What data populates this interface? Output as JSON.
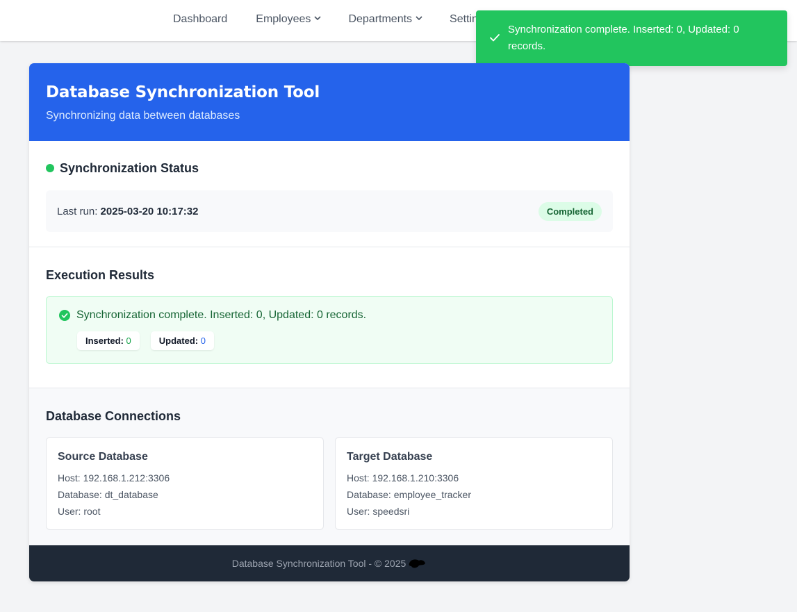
{
  "nav": {
    "items": [
      {
        "label": "Dashboard",
        "dropdown": false
      },
      {
        "label": "Employees",
        "dropdown": true
      },
      {
        "label": "Departments",
        "dropdown": true
      },
      {
        "label": "Settings",
        "dropdown": false
      }
    ]
  },
  "toast": {
    "icon": "check-icon",
    "message": "Synchronization complete. Inserted: 0, Updated: 0 records.",
    "color": "#22c55e"
  },
  "header": {
    "title": "Database Synchronization Tool",
    "subtitle": "Synchronizing data between databases",
    "color": "#2563eb"
  },
  "status": {
    "title": "Synchronization Status",
    "last_run_label": "Last run:",
    "last_run_value": "2025-03-20 10:17:32",
    "badge": "Completed"
  },
  "results": {
    "title": "Execution Results",
    "message": "Synchronization complete. Inserted: 0, Updated: 0 records.",
    "inserted_label": "Inserted:",
    "inserted_value": "0",
    "updated_label": "Updated:",
    "updated_value": "0"
  },
  "connections": {
    "title": "Database Connections",
    "source": {
      "title": "Source Database",
      "host": "Host: 192.168.1.212:3306",
      "database": "Database: dt_database",
      "user": "User: root"
    },
    "target": {
      "title": "Target Database",
      "host": "Host: 192.168.1.210:3306",
      "database": "Database: employee_tracker",
      "user": "User: speedsri"
    }
  },
  "footer": {
    "text": "Database Synchronization Tool - © 2025"
  }
}
